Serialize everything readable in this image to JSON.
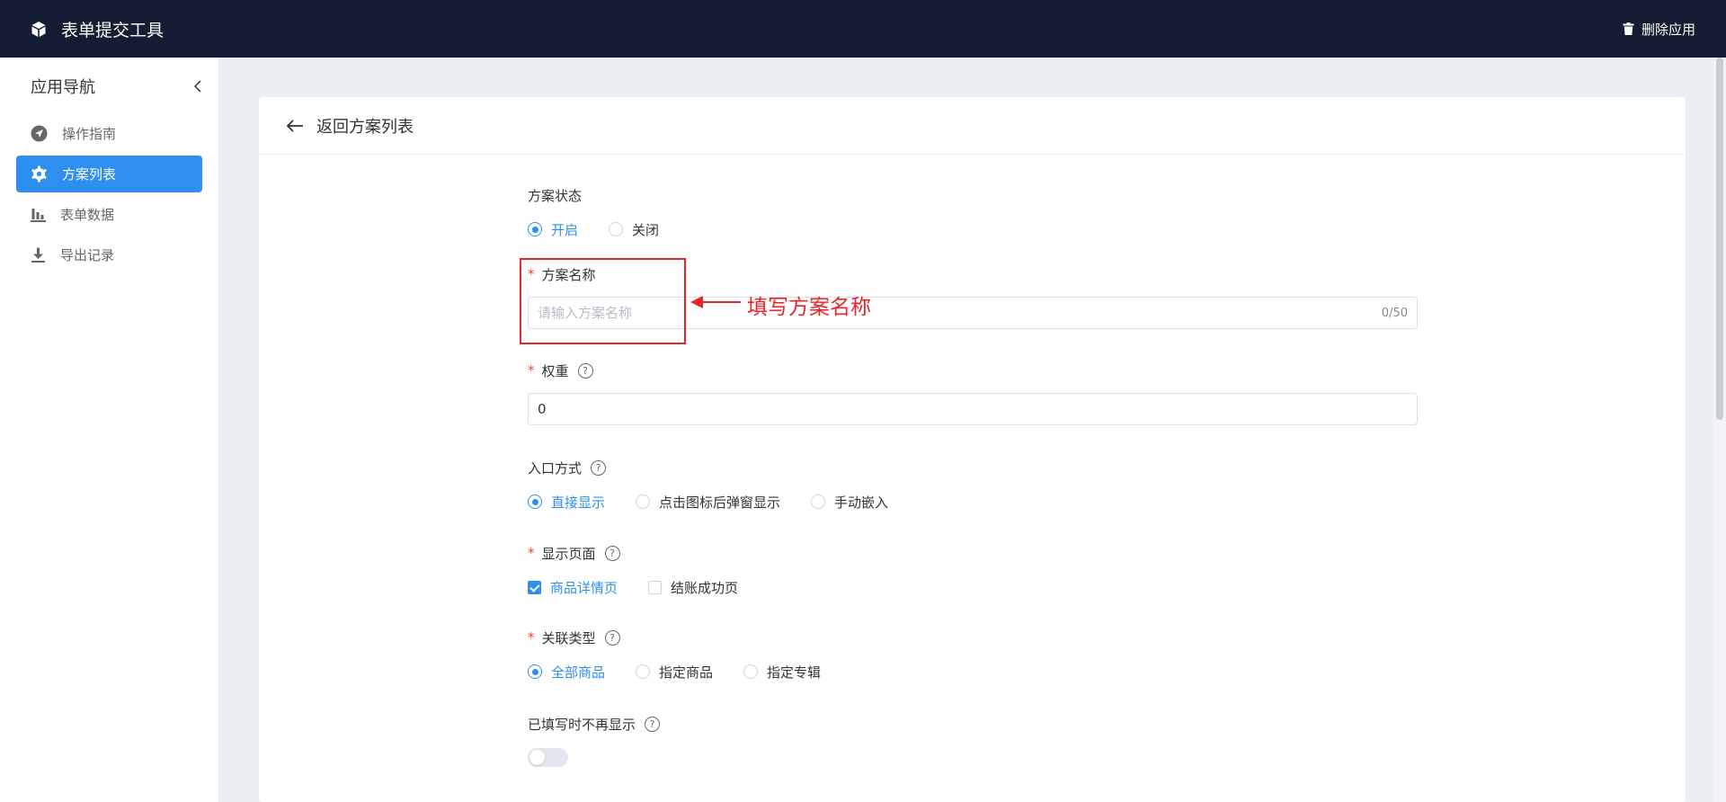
{
  "header": {
    "title": "表单提交工具",
    "delete_label": "删除应用"
  },
  "sidebar": {
    "title": "应用导航",
    "items": [
      {
        "label": "操作指南",
        "icon": "navigation-icon",
        "active": false
      },
      {
        "label": "方案列表",
        "icon": "gear-icon",
        "active": true
      },
      {
        "label": "表单数据",
        "icon": "bar-chart-icon",
        "active": false
      },
      {
        "label": "导出记录",
        "icon": "download-icon",
        "active": false
      }
    ]
  },
  "main": {
    "back_label": "返回方案列表",
    "form": {
      "status": {
        "label": "方案状态",
        "options": [
          "开启",
          "关闭"
        ],
        "selected": "开启"
      },
      "name": {
        "label": "方案名称",
        "required": true,
        "placeholder": "请输入方案名称",
        "value": "",
        "counter": "0/50"
      },
      "weight": {
        "label": "权重",
        "required": true,
        "value": "0"
      },
      "entry": {
        "label": "入口方式",
        "options": [
          "直接显示",
          "点击图标后弹窗显示",
          "手动嵌入"
        ],
        "selected": "直接显示"
      },
      "pages": {
        "label": "显示页面",
        "required": true,
        "options": [
          "商品详情页",
          "结账成功页"
        ],
        "checked": [
          "商品详情页"
        ]
      },
      "link_type": {
        "label": "关联类型",
        "required": true,
        "options": [
          "全部商品",
          "指定商品",
          "指定专辑"
        ],
        "selected": "全部商品"
      },
      "hide_after_fill": {
        "label": "已填写时不再显示",
        "enabled": false
      }
    }
  },
  "annotation": {
    "text": "填写方案名称",
    "color": "#e8252b"
  },
  "colors": {
    "header_bg": "#141d33",
    "accent": "#2f8ff0",
    "page_bg": "#ebeef3"
  }
}
